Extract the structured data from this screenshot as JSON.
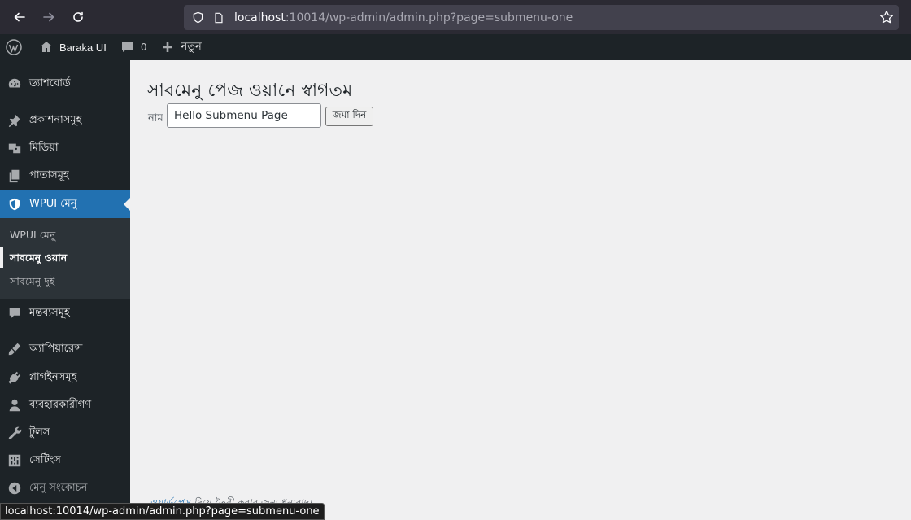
{
  "browser": {
    "url_host": "localhost",
    "url_rest": ":10014/wp-admin/admin.php?page=submenu-one"
  },
  "adminbar": {
    "site_name": "Baraka UI",
    "comment_count": "0",
    "new_label": "নতুন"
  },
  "sidebar": {
    "items": [
      {
        "label": "ড্যাশবোর্ড",
        "icon": "dashboard-icon"
      },
      {
        "label": "প্রকাশনাসমূহ",
        "icon": "pin-icon"
      },
      {
        "label": "মিডিয়া",
        "icon": "media-icon"
      },
      {
        "label": "পাতাসমূহ",
        "icon": "page-icon"
      },
      {
        "label": "WPUI মেনু",
        "icon": "shield-icon"
      },
      {
        "label": "মন্তব্যসমূহ",
        "icon": "comment-icon"
      },
      {
        "label": "অ্যাপিয়ারেন্স",
        "icon": "brush-icon"
      },
      {
        "label": "প্লাগইনসমূহ",
        "icon": "plugin-icon"
      },
      {
        "label": "ব্যবহারকারীগণ",
        "icon": "user-icon"
      },
      {
        "label": "টুলস",
        "icon": "wrench-icon"
      },
      {
        "label": "সেটিংস",
        "icon": "settings-icon"
      },
      {
        "label": "মেনু সংকোচন",
        "icon": "collapse-icon"
      }
    ],
    "submenu": [
      "WPUI মেনু",
      "সাবমেনু ওয়ান",
      "সাবমেনু দুই"
    ]
  },
  "main": {
    "title": "সাবমেনু পেজ ওয়ানে স্বাগতম",
    "field_label": "নাম",
    "field_value": "Hello Submenu Page",
    "submit_label": "জমা দিন",
    "footer_link": "ওয়ার্ডপ্রেস",
    "footer_rest": " দিয়ে তৈরী করার জন্য ধন্যবাদ।"
  },
  "status_url": "localhost:10014/wp-admin/admin.php?page=submenu-one"
}
